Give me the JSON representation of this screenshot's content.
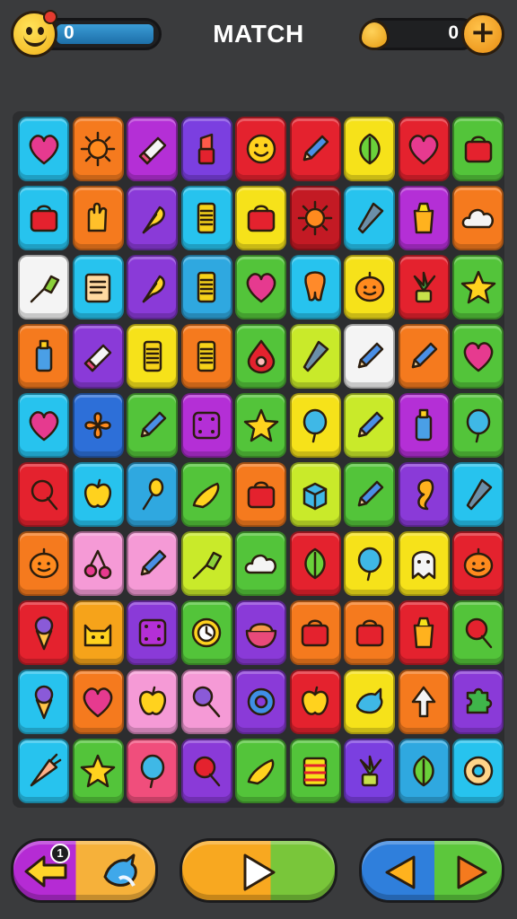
{
  "header": {
    "title": "MATCH",
    "score": "0",
    "coins": "0",
    "plus_label": "+",
    "score_icon": "smiley-face-icon",
    "coin_icon": "coin-icon"
  },
  "board": {
    "rows": 10,
    "cols": 9,
    "tiles": [
      [
        {
          "color": "#27c3ee",
          "icon": "heart"
        },
        {
          "color": "#f57a1e",
          "icon": "sun"
        },
        {
          "color": "#b42fd6",
          "icon": "eraser"
        },
        {
          "color": "#7b3fe0",
          "icon": "lipstick"
        },
        {
          "color": "#e4222e",
          "icon": "smiley"
        },
        {
          "color": "#e4222e",
          "icon": "pencil"
        },
        {
          "color": "#f6e21a",
          "icon": "leaf"
        },
        {
          "color": "#e4222e",
          "icon": "heart"
        },
        {
          "color": "#53c43a",
          "icon": "bag"
        }
      ],
      [
        {
          "color": "#27c3ee",
          "icon": "bag"
        },
        {
          "color": "#f57a1e",
          "icon": "hand"
        },
        {
          "color": "#8a3ad8",
          "icon": "feather"
        },
        {
          "color": "#27c3ee",
          "icon": "phone"
        },
        {
          "color": "#f6e21a",
          "icon": "bag"
        },
        {
          "color": "#c31a24",
          "icon": "sun"
        },
        {
          "color": "#27c3ee",
          "icon": "cone"
        },
        {
          "color": "#b42fd6",
          "icon": "cup"
        },
        {
          "color": "#f57a1e",
          "icon": "cloud"
        }
      ],
      [
        {
          "color": "#f4f4f4",
          "icon": "brush"
        },
        {
          "color": "#27c3ee",
          "icon": "note"
        },
        {
          "color": "#8a3ad8",
          "icon": "feather"
        },
        {
          "color": "#2fa8e0",
          "icon": "phone"
        },
        {
          "color": "#53c43a",
          "icon": "heart"
        },
        {
          "color": "#27c3ee",
          "icon": "tooth"
        },
        {
          "color": "#f6e21a",
          "icon": "pumpkin"
        },
        {
          "color": "#e4222e",
          "icon": "plant"
        },
        {
          "color": "#53c43a",
          "icon": "star"
        }
      ],
      [
        {
          "color": "#f57a1e",
          "icon": "bottle"
        },
        {
          "color": "#8a3ad8",
          "icon": "eraser"
        },
        {
          "color": "#f6e21a",
          "icon": "phone"
        },
        {
          "color": "#f57a1e",
          "icon": "phone"
        },
        {
          "color": "#53c43a",
          "icon": "drop"
        },
        {
          "color": "#c9ea2a",
          "icon": "cone"
        },
        {
          "color": "#f4f4f4",
          "icon": "pencil"
        },
        {
          "color": "#f57a1e",
          "icon": "pencil"
        },
        {
          "color": "#53c43a",
          "icon": "heart"
        }
      ],
      [
        {
          "color": "#27c3ee",
          "icon": "heart"
        },
        {
          "color": "#2d6fd8",
          "icon": "flower"
        },
        {
          "color": "#53c43a",
          "icon": "pencil"
        },
        {
          "color": "#b42fd6",
          "icon": "dice"
        },
        {
          "color": "#53c43a",
          "icon": "star"
        },
        {
          "color": "#f6e21a",
          "icon": "balloon"
        },
        {
          "color": "#c9ea2a",
          "icon": "pencil"
        },
        {
          "color": "#b42fd6",
          "icon": "bottle"
        },
        {
          "color": "#53c43a",
          "icon": "balloon"
        }
      ],
      [
        {
          "color": "#e4222e",
          "icon": "lollipop"
        },
        {
          "color": "#27c3ee",
          "icon": "apple"
        },
        {
          "color": "#2fa8e0",
          "icon": "spoon"
        },
        {
          "color": "#53c43a",
          "icon": "pepper"
        },
        {
          "color": "#f57a1e",
          "icon": "bag"
        },
        {
          "color": "#c9ea2a",
          "icon": "box"
        },
        {
          "color": "#53c43a",
          "icon": "pencil"
        },
        {
          "color": "#8a3ad8",
          "icon": "seahorse"
        },
        {
          "color": "#27c3ee",
          "icon": "cone"
        }
      ],
      [
        {
          "color": "#f57a1e",
          "icon": "pumpkin"
        },
        {
          "color": "#f59ad6",
          "icon": "cherries"
        },
        {
          "color": "#f59ad6",
          "icon": "pencil"
        },
        {
          "color": "#c9ea2a",
          "icon": "brush"
        },
        {
          "color": "#53c43a",
          "icon": "cloud"
        },
        {
          "color": "#e4222e",
          "icon": "leaf"
        },
        {
          "color": "#f6e21a",
          "icon": "balloon"
        },
        {
          "color": "#f6e21a",
          "icon": "ghost"
        },
        {
          "color": "#e4222e",
          "icon": "pumpkin"
        }
      ],
      [
        {
          "color": "#e4222e",
          "icon": "icecream"
        },
        {
          "color": "#f6a31a",
          "icon": "cat"
        },
        {
          "color": "#8a3ad8",
          "icon": "dice"
        },
        {
          "color": "#53c43a",
          "icon": "clock"
        },
        {
          "color": "#8a3ad8",
          "icon": "bowl"
        },
        {
          "color": "#f57a1e",
          "icon": "bag"
        },
        {
          "color": "#f57a1e",
          "icon": "bag"
        },
        {
          "color": "#e4222e",
          "icon": "cup"
        },
        {
          "color": "#53c43a",
          "icon": "lollipop"
        }
      ],
      [
        {
          "color": "#27c3ee",
          "icon": "icecream"
        },
        {
          "color": "#f57a1e",
          "icon": "heart"
        },
        {
          "color": "#f59ad6",
          "icon": "apple"
        },
        {
          "color": "#f59ad6",
          "icon": "mirror"
        },
        {
          "color": "#8a3ad8",
          "icon": "ring"
        },
        {
          "color": "#e4222e",
          "icon": "apple"
        },
        {
          "color": "#f6e21a",
          "icon": "bird"
        },
        {
          "color": "#f57a1e",
          "icon": "tree"
        },
        {
          "color": "#8a3ad8",
          "icon": "puzzle"
        }
      ],
      [
        {
          "color": "#27c3ee",
          "icon": "carrot"
        },
        {
          "color": "#53c43a",
          "icon": "star"
        },
        {
          "color": "#f04e7c",
          "icon": "balloon"
        },
        {
          "color": "#8a3ad8",
          "icon": "lollipop"
        },
        {
          "color": "#53c43a",
          "icon": "pepper"
        },
        {
          "color": "#53c43a",
          "icon": "cake"
        },
        {
          "color": "#7b3fe0",
          "icon": "plant"
        },
        {
          "color": "#2fa8e0",
          "icon": "leaf"
        },
        {
          "color": "#27c3ee",
          "icon": "donut"
        }
      ]
    ]
  },
  "controls": {
    "hint_count": "1",
    "back_icon": "arrow-left-icon",
    "shuffle_icon": "bird-icon",
    "play_icon": "play-icon",
    "prev_icon": "triangle-left-icon",
    "next_icon": "triangle-right-icon"
  }
}
